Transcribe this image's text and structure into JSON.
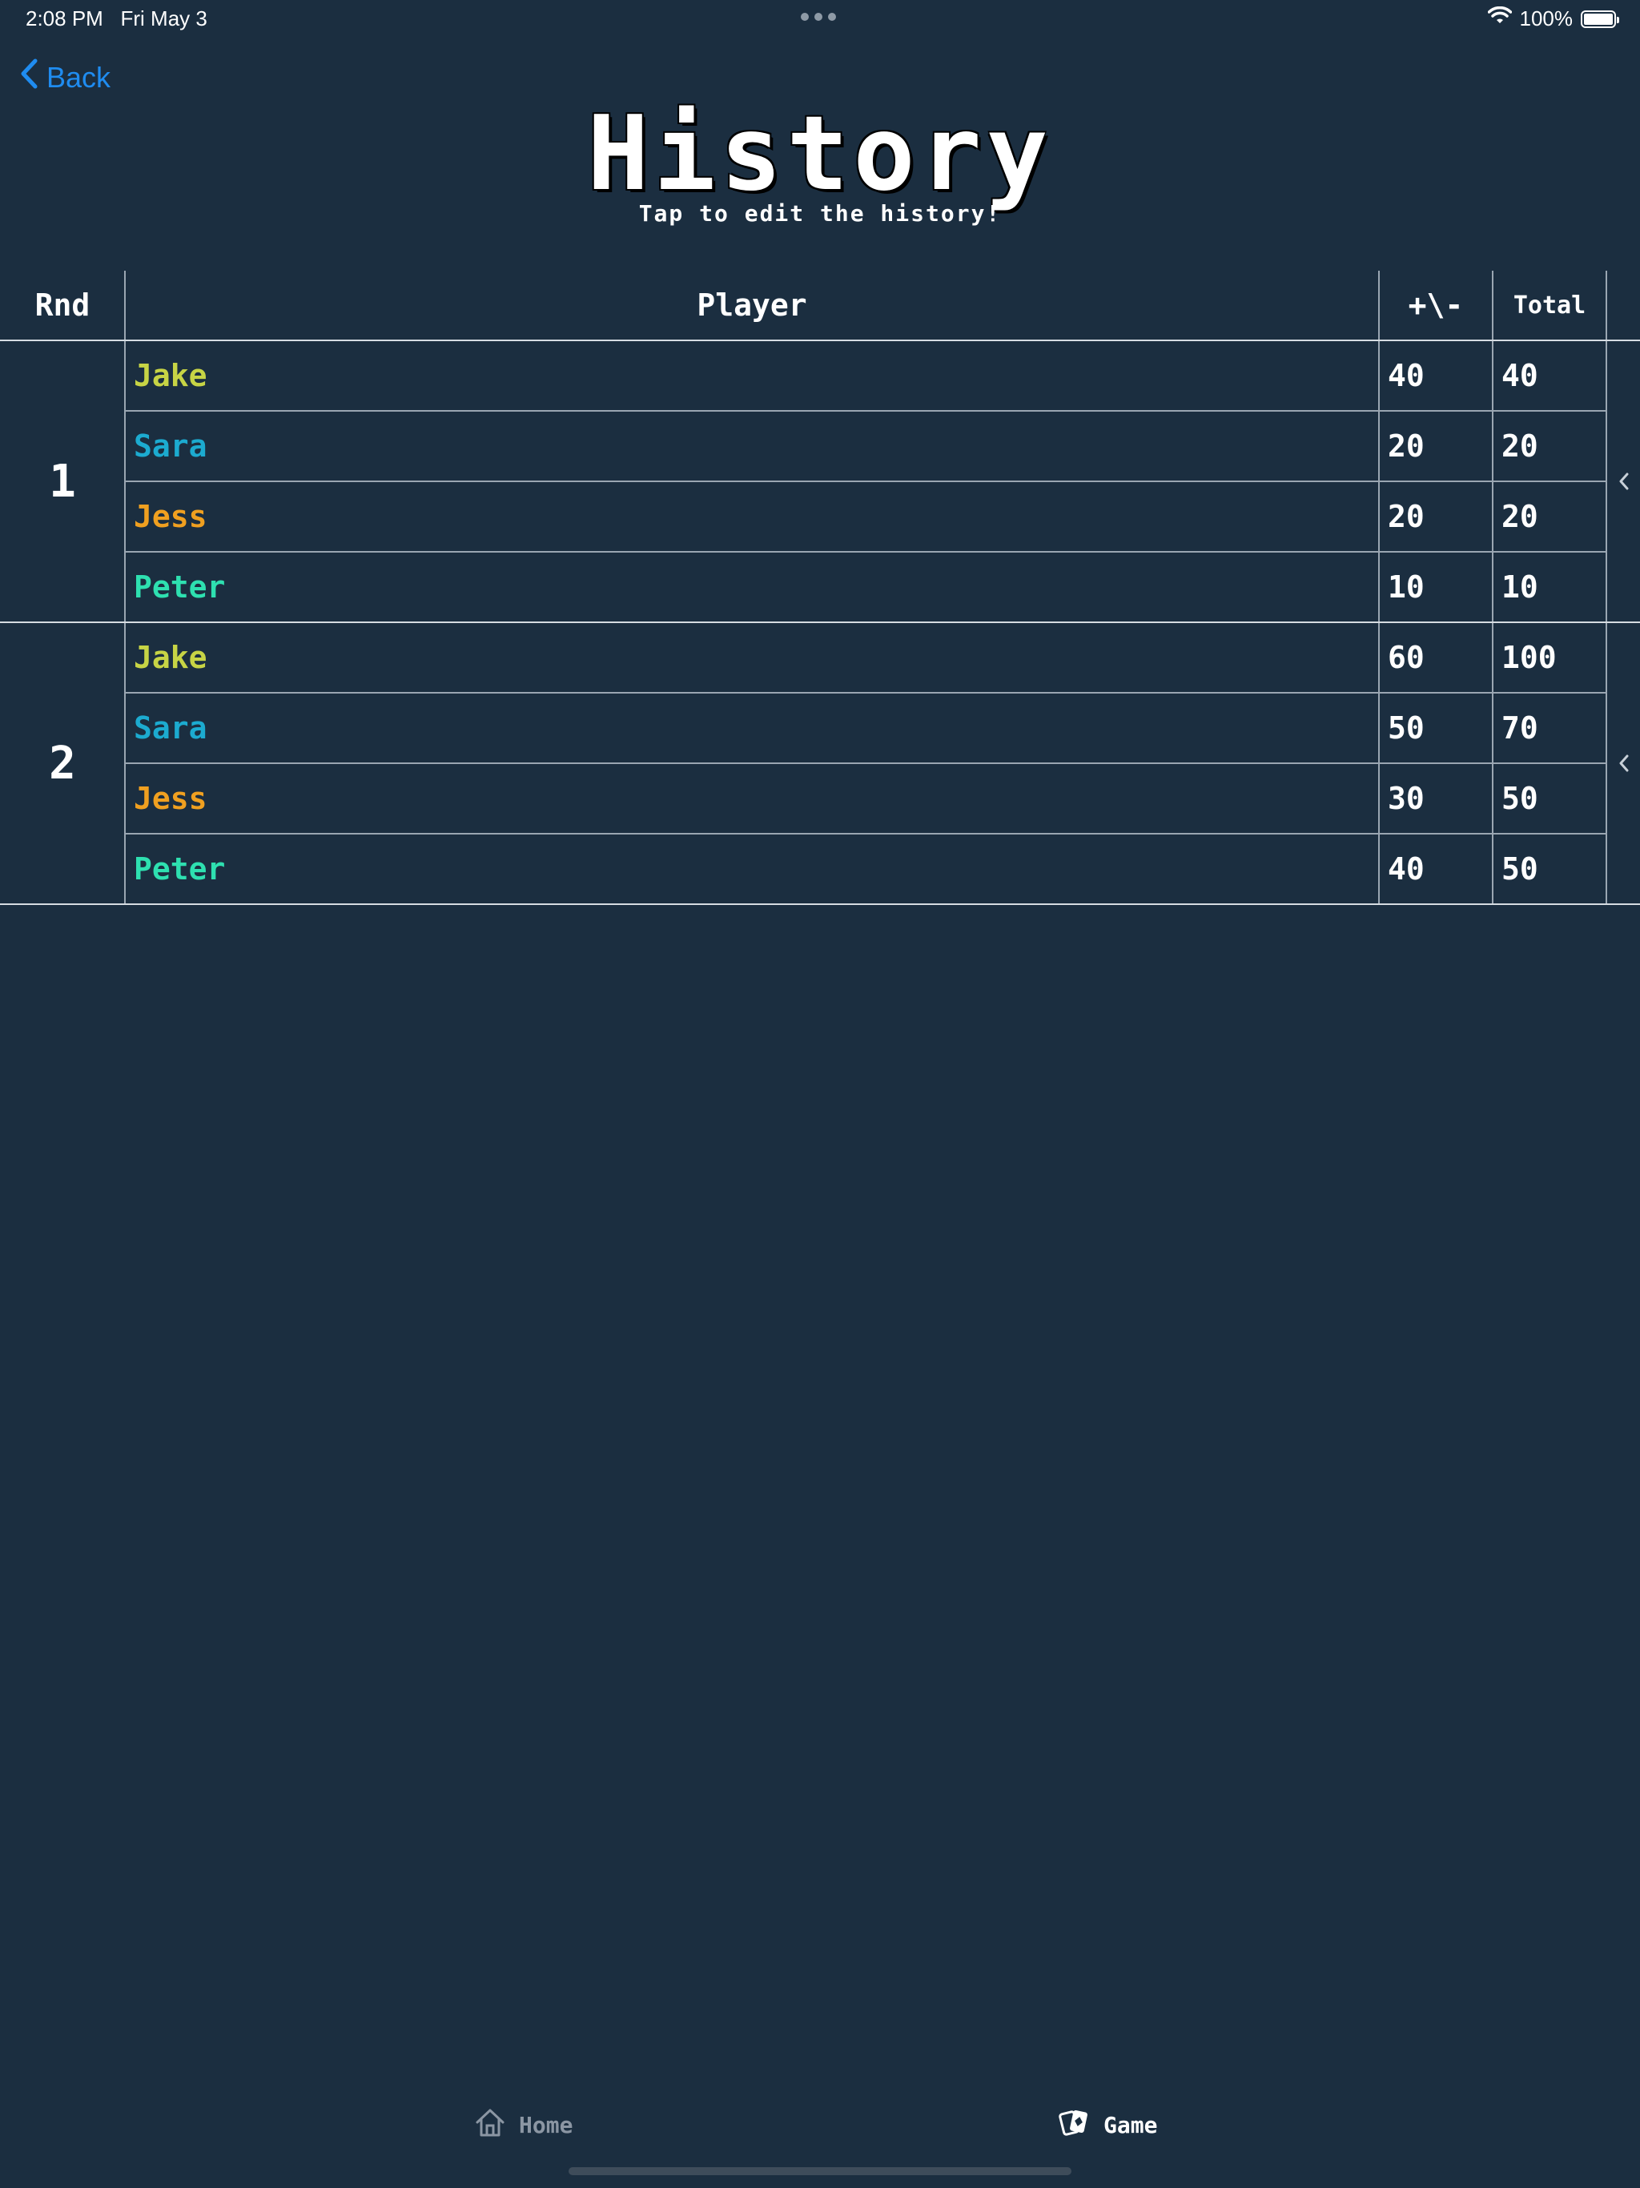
{
  "status_bar": {
    "time": "2:08 PM",
    "date": "Fri May 3",
    "battery": "100%",
    "battery_level": 1.0
  },
  "nav": {
    "back_label": "Back"
  },
  "header": {
    "title": "History",
    "subtitle": "Tap to edit the history!"
  },
  "table": {
    "columns": {
      "round": "Rnd",
      "player": "Player",
      "delta": "+\\-",
      "total": "Total"
    },
    "rounds": [
      {
        "round": "1",
        "rows": [
          {
            "player": "Jake",
            "delta": "40",
            "total": "40",
            "color": "#c7d445"
          },
          {
            "player": "Sara",
            "delta": "20",
            "total": "20",
            "color": "#1cabd0"
          },
          {
            "player": "Jess",
            "delta": "20",
            "total": "20",
            "color": "#f0a020"
          },
          {
            "player": "Peter",
            "delta": "10",
            "total": "10",
            "color": "#2ee0b0"
          }
        ]
      },
      {
        "round": "2",
        "rows": [
          {
            "player": "Jake",
            "delta": "60",
            "total": "100",
            "color": "#c7d445"
          },
          {
            "player": "Sara",
            "delta": "50",
            "total": "70",
            "color": "#1cabd0"
          },
          {
            "player": "Jess",
            "delta": "30",
            "total": "50",
            "color": "#f0a020"
          },
          {
            "player": "Peter",
            "delta": "40",
            "total": "50",
            "color": "#2ee0b0"
          }
        ]
      }
    ]
  },
  "tab_bar": {
    "home_label": "Home",
    "game_label": "Game"
  },
  "colors": {
    "background": "#1b2e40",
    "accent": "#1f8cf0",
    "jake": "#c7d445",
    "sara": "#1cabd0",
    "jess": "#f0a020",
    "peter": "#2ee0b0"
  }
}
